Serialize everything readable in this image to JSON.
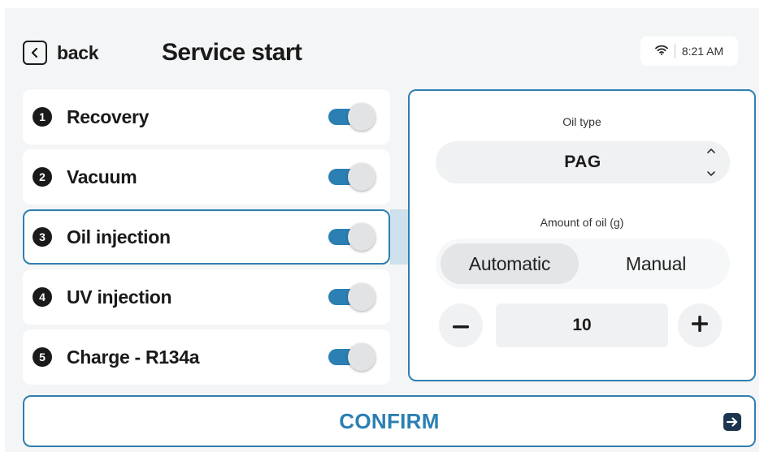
{
  "header": {
    "back_label": "back",
    "title": "Service start",
    "status": {
      "wifi_icon": "wifi-icon",
      "time": "8:21 AM"
    }
  },
  "steps": [
    {
      "number": "1",
      "label": "Recovery",
      "enabled": true,
      "active": false
    },
    {
      "number": "2",
      "label": "Vacuum",
      "enabled": true,
      "active": false
    },
    {
      "number": "3",
      "label": "Oil injection",
      "enabled": true,
      "active": true
    },
    {
      "number": "4",
      "label": "UV injection",
      "enabled": true,
      "active": false
    },
    {
      "number": "5",
      "label": "Charge - R134a",
      "enabled": true,
      "active": false
    }
  ],
  "oil_panel": {
    "oil_type_label": "Oil type",
    "oil_type_value": "PAG",
    "amount_label": "Amount of oil (g)",
    "modes": [
      "Automatic",
      "Manual"
    ],
    "selected_mode": "Automatic",
    "amount_value": "10",
    "decrement_symbol": "−",
    "increment_symbol": "+"
  },
  "confirm": {
    "label": "CONFIRM",
    "icon": "arrow-right-icon"
  },
  "colors": {
    "accent": "#2b7fb3",
    "border_active": "#2e7fb0",
    "toggle_knob": "#e2e3e5",
    "confirm_icon_bg": "#1c3650"
  }
}
